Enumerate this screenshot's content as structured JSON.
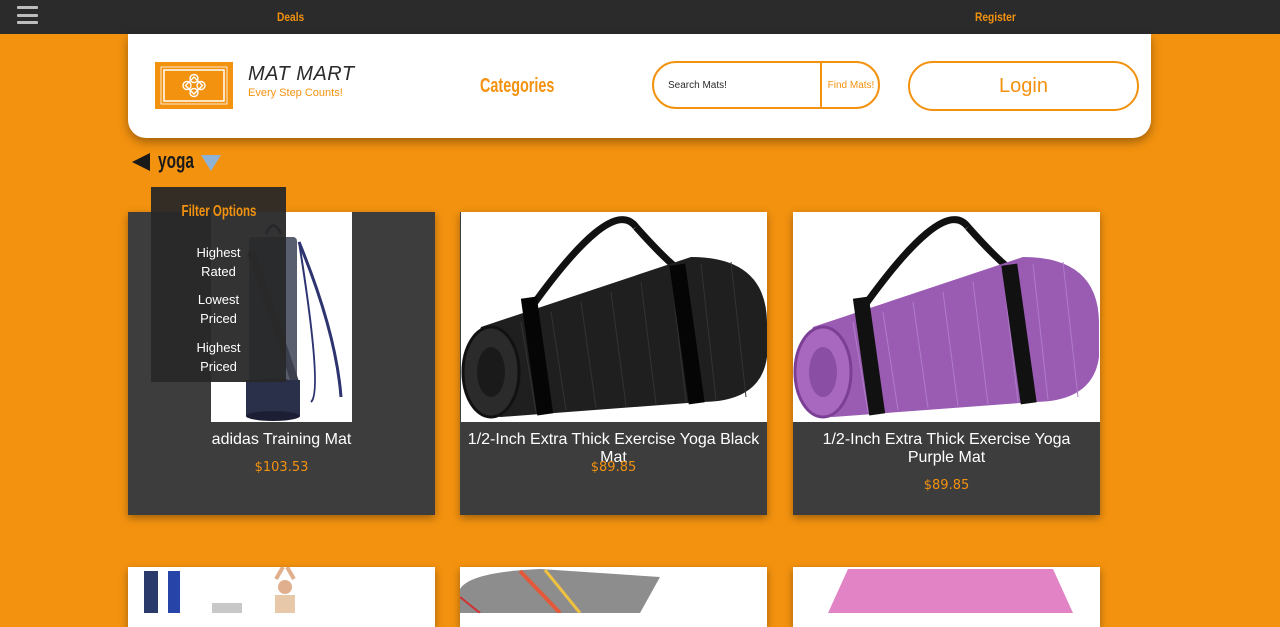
{
  "topbar": {
    "deals_label": "Deals",
    "register_label": "Register"
  },
  "header": {
    "brand_name": "MAT MART",
    "brand_tagline": "Every Step Counts!",
    "categories_label": "Categories",
    "search_placeholder": "Search Mats!",
    "search_button_label": "Find Mats!",
    "login_label": "Login"
  },
  "breadcrumb": {
    "current": "yoga"
  },
  "filter": {
    "title": "Filter Options",
    "options": [
      "Highest Rated",
      "Lowest Priced",
      "Highest Priced"
    ]
  },
  "products": [
    {
      "name": "adidas Training Mat",
      "price": "$103.53"
    },
    {
      "name": "1/2-Inch Extra Thick Exercise Yoga Black Mat",
      "price": "$89.85"
    },
    {
      "name": "1/2-Inch Extra Thick Exercise Yoga Purple Mat",
      "price": "$89.85"
    }
  ],
  "colors": {
    "accent": "#f3920f",
    "topbar": "#2b2b2b",
    "card": "#3d3d3d"
  }
}
